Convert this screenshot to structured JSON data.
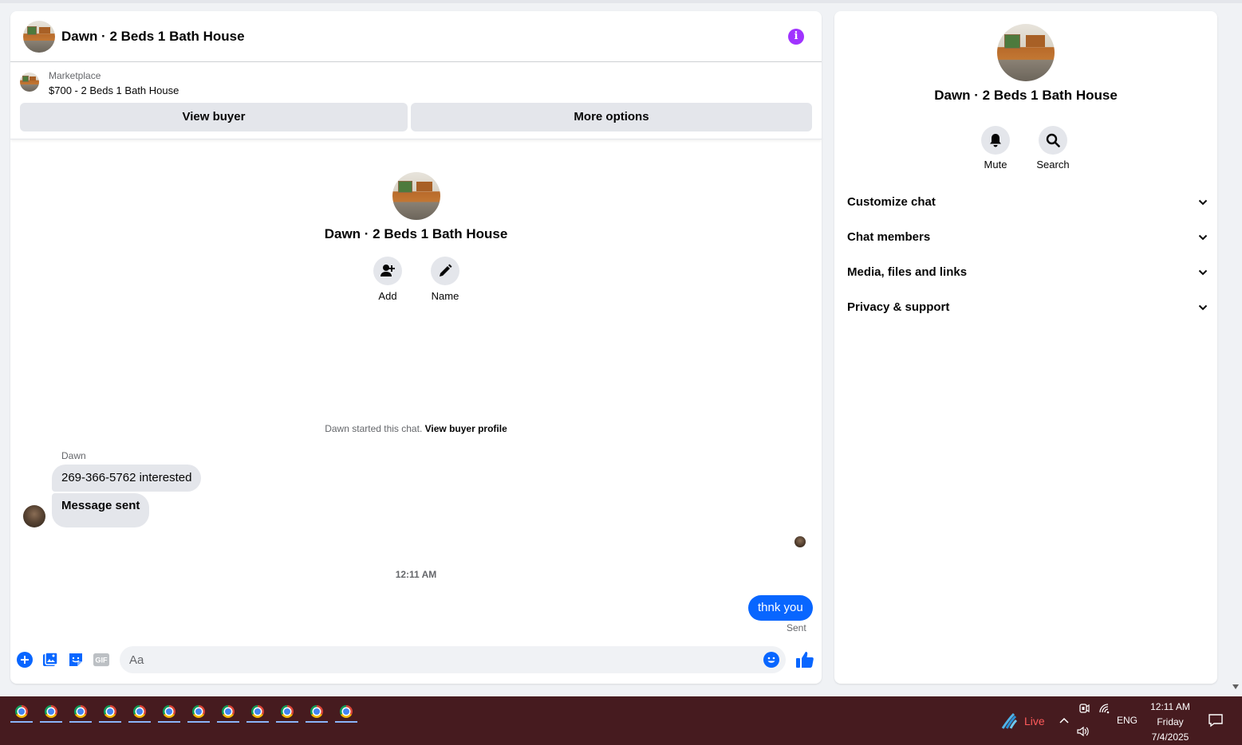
{
  "chat": {
    "title": "Dawn · 2 Beds 1 Bath House",
    "marketplace_label": "Marketplace",
    "listing_title": "$700 - 2 Beds 1 Bath House",
    "view_buyer_label": "View buyer",
    "more_options_label": "More options",
    "profile_name": "Dawn · 2 Beds 1 Bath House",
    "add_label": "Add",
    "name_label": "Name",
    "started_text": "Dawn started this chat.",
    "view_buyer_profile_label": "View buyer profile",
    "sender_name": "Dawn",
    "messages_in": [
      "269-366-5762 interested",
      "Message sent"
    ],
    "time_separator": "12:11 AM",
    "message_out": "thnk you",
    "sent_status": "Sent",
    "composer_placeholder": "Aa",
    "gif_label": "GIF"
  },
  "info": {
    "name": "Dawn · 2 Beds 1 Bath House",
    "mute_label": "Mute",
    "search_label": "Search",
    "sections": [
      "Customize chat",
      "Chat members",
      "Media, files and links",
      "Privacy & support"
    ]
  },
  "taskbar": {
    "apps": [
      "chrome-icon",
      "chrome-icon",
      "chrome-icon",
      "chrome-icon",
      "chrome-icon",
      "chrome-icon",
      "chrome-icon",
      "chrome-icon",
      "chrome-icon",
      "chrome-icon",
      "chrome-icon",
      "chrome-icon"
    ],
    "live_label": "Live",
    "language": "ENG",
    "time": "12:11 AM",
    "day": "Friday",
    "date": "7/4/2025"
  },
  "colors": {
    "accent": "#0866ff",
    "info_icon": "#a033ff",
    "taskbar_bg": "#461b1f"
  }
}
